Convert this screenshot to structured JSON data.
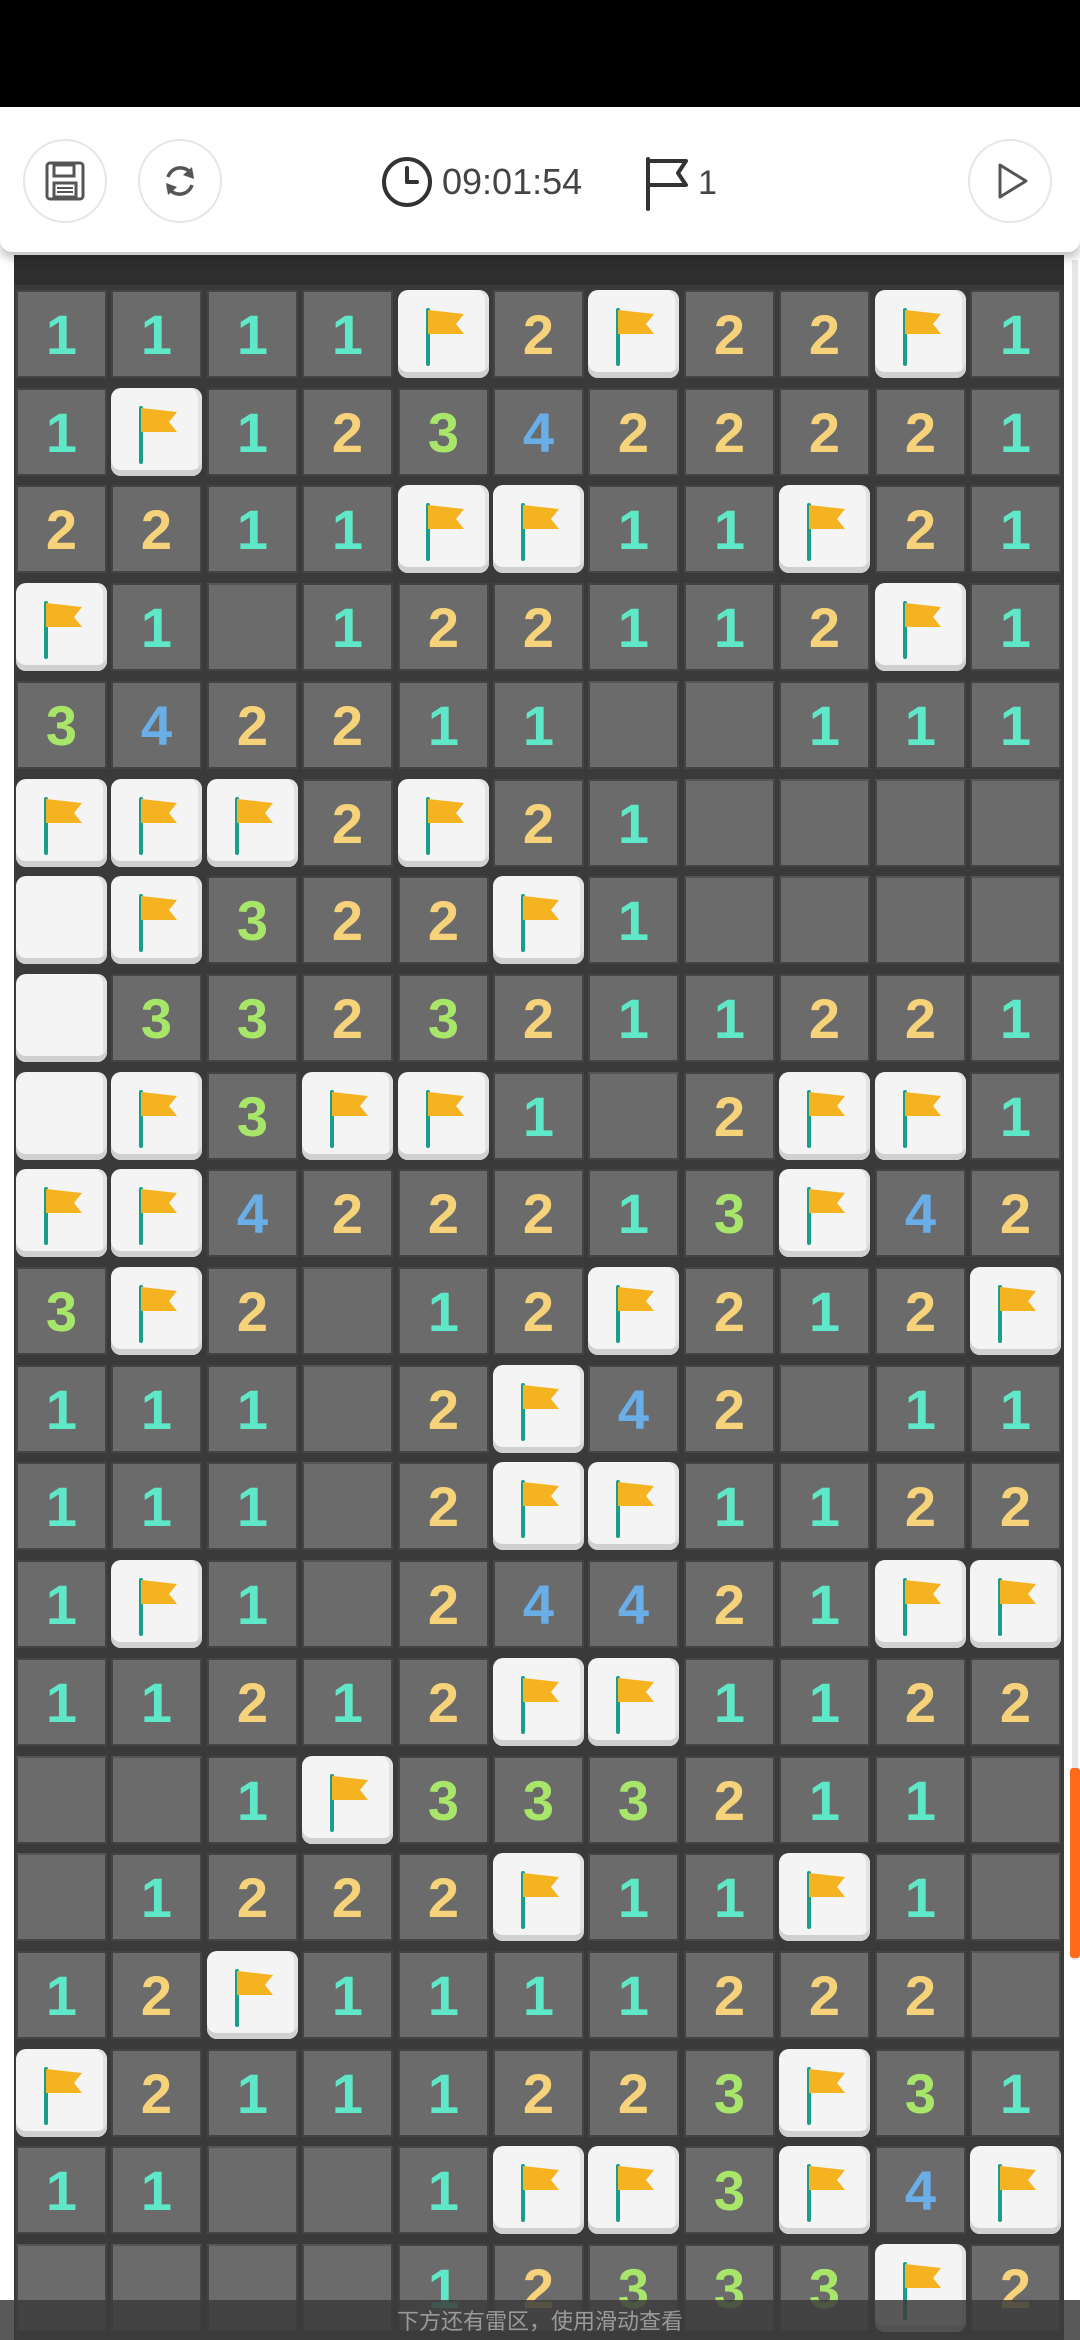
{
  "header": {
    "timer": "09:01:54",
    "flags_remaining": "1",
    "icons": {
      "save": "save-icon",
      "restart": "refresh-icon",
      "clock": "clock-icon",
      "flag": "flag-outline-icon",
      "play": "play-icon"
    }
  },
  "colors": {
    "n1": "#5ee8c8",
    "n2": "#f6d27a",
    "n3": "#a8e66a",
    "n4": "#6aaee8",
    "flag": "#f5b321",
    "accent": "#ff6a1a"
  },
  "board": {
    "rows": [
      [
        "1",
        "1",
        "1",
        "1",
        "F",
        "2",
        "F",
        "2",
        "2",
        "F",
        "1"
      ],
      [
        "1",
        "F",
        "1",
        "2",
        "3",
        "4",
        "2",
        "2",
        "2",
        "2",
        "1"
      ],
      [
        "2",
        "2",
        "1",
        "1",
        "F",
        "F",
        "1",
        "1",
        "F",
        "2",
        "1"
      ],
      [
        "F",
        "1",
        "",
        "1",
        "2",
        "2",
        "1",
        "1",
        "2",
        "F",
        "1"
      ],
      [
        "3",
        "4",
        "2",
        "2",
        "1",
        "1",
        "",
        "",
        "1",
        "1",
        "1"
      ],
      [
        "F",
        "F",
        "F",
        "2",
        "F",
        "2",
        "1",
        "",
        "",
        "",
        ""
      ],
      [
        "C",
        "F",
        "3",
        "2",
        "2",
        "F",
        "1",
        "",
        "",
        "",
        ""
      ],
      [
        "C",
        "3",
        "3",
        "2",
        "3",
        "2",
        "1",
        "1",
        "2",
        "2",
        "1"
      ],
      [
        "C",
        "F",
        "3",
        "F",
        "F",
        "1",
        "",
        "2",
        "F",
        "F",
        "1"
      ],
      [
        "F",
        "F",
        "4",
        "2",
        "2",
        "2",
        "1",
        "3",
        "F",
        "4",
        "2"
      ],
      [
        "3",
        "F",
        "2",
        "",
        "1",
        "2",
        "F",
        "2",
        "1",
        "2",
        "F"
      ],
      [
        "1",
        "1",
        "1",
        "",
        "2",
        "F",
        "4",
        "2",
        "",
        "1",
        "1"
      ],
      [
        "1",
        "1",
        "1",
        "",
        "2",
        "F",
        "F",
        "1",
        "1",
        "2",
        "2"
      ],
      [
        "1",
        "F",
        "1",
        "",
        "2",
        "4",
        "4",
        "2",
        "1",
        "F",
        "F"
      ],
      [
        "1",
        "1",
        "2",
        "1",
        "2",
        "F",
        "F",
        "1",
        "1",
        "2",
        "2"
      ],
      [
        "",
        "",
        "1",
        "F",
        "3",
        "3",
        "3",
        "2",
        "1",
        "1",
        ""
      ],
      [
        "",
        "1",
        "2",
        "2",
        "2",
        "F",
        "1",
        "1",
        "F",
        "1",
        ""
      ],
      [
        "1",
        "2",
        "F",
        "1",
        "1",
        "1",
        "1",
        "2",
        "2",
        "2",
        ""
      ],
      [
        "F",
        "2",
        "1",
        "1",
        "1",
        "2",
        "2",
        "3",
        "F",
        "3",
        "1"
      ],
      [
        "1",
        "1",
        "",
        "",
        "1",
        "F",
        "F",
        "3",
        "F",
        "4",
        "F"
      ],
      [
        "",
        "",
        "",
        "",
        "1",
        "2",
        "3",
        "3",
        "3",
        "F",
        "2"
      ]
    ]
  },
  "toast": "下方还有雷区，使用滑动查看"
}
